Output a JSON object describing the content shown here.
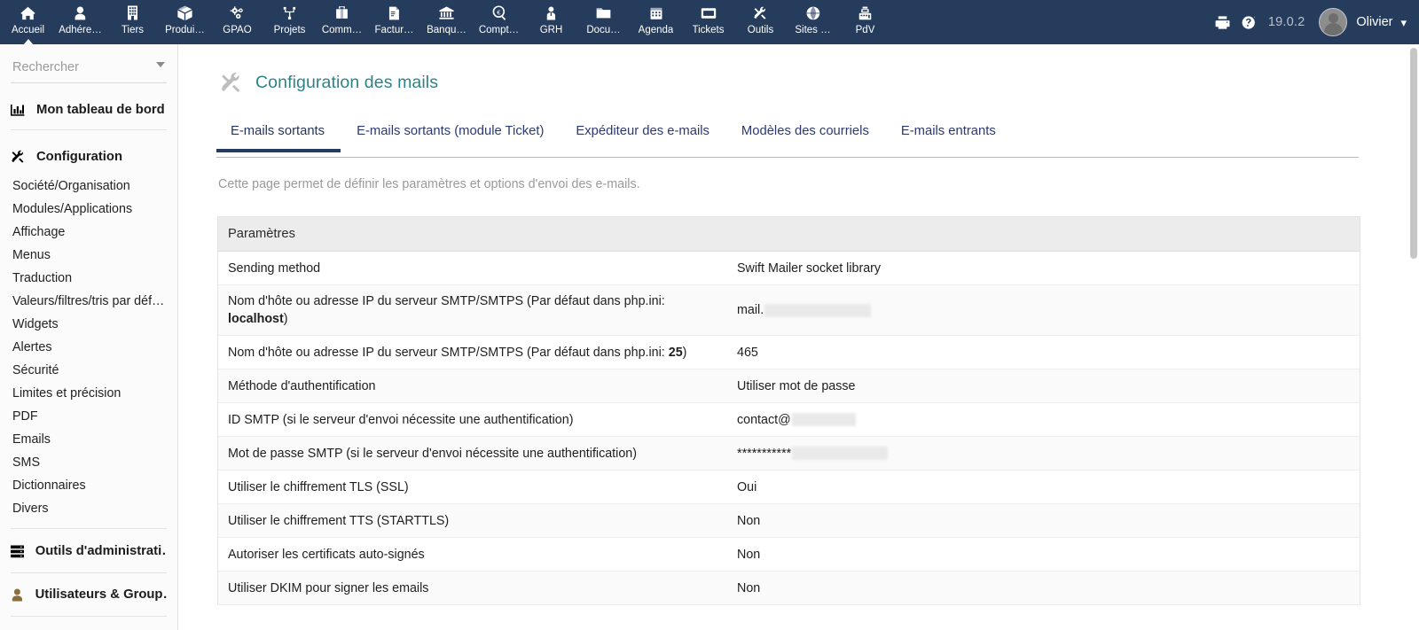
{
  "topnav": {
    "items": [
      {
        "label": "Accueil",
        "icon": "home-icon",
        "active": true
      },
      {
        "label": "Adhére…",
        "icon": "member-icon",
        "active": false
      },
      {
        "label": "Tiers",
        "icon": "building-icon",
        "active": false
      },
      {
        "label": "Produi…",
        "icon": "box-icon",
        "active": false
      },
      {
        "label": "GPAO",
        "icon": "gears-icon",
        "active": false
      },
      {
        "label": "Projets",
        "icon": "project-tree-icon",
        "active": false
      },
      {
        "label": "Comm…",
        "icon": "briefcase-icon",
        "active": false
      },
      {
        "label": "Factur…",
        "icon": "invoice-icon",
        "active": false
      },
      {
        "label": "Banqu…",
        "icon": "bank-icon",
        "active": false
      },
      {
        "label": "Compt…",
        "icon": "accounting-magnifier-icon",
        "active": false
      },
      {
        "label": "GRH",
        "icon": "hr-person-icon",
        "active": false
      },
      {
        "label": "Docu…",
        "icon": "folder-icon",
        "active": false
      },
      {
        "label": "Agenda",
        "icon": "calendar-icon",
        "active": false
      },
      {
        "label": "Tickets",
        "icon": "ticket-icon",
        "active": false
      },
      {
        "label": "Outils",
        "icon": "tools-icon",
        "active": false
      },
      {
        "label": "Sites …",
        "icon": "globe-icon",
        "active": false
      },
      {
        "label": "PdV",
        "icon": "cash-register-icon",
        "active": false
      }
    ],
    "print_icon": "printer-icon",
    "help_icon": "help-question-icon",
    "version": "19.0.2",
    "avatar": "user-avatar",
    "username": "Olivier",
    "user_caret": "chevron-down-icon"
  },
  "sidebar": {
    "search": {
      "placeholder": "Rechercher",
      "value": "",
      "caret": "dropdown-caret-icon"
    },
    "dashboard": {
      "label": "Mon tableau de bord",
      "icon": "chart-bar-icon"
    },
    "configuration": {
      "label": "Configuration",
      "icon": "tools-wrench-icon"
    },
    "config_items": [
      {
        "label": "Société/Organisation"
      },
      {
        "label": "Modules/Applications"
      },
      {
        "label": "Affichage"
      },
      {
        "label": "Menus"
      },
      {
        "label": "Traduction"
      },
      {
        "label": "Valeurs/filtres/tris par déf…"
      },
      {
        "label": "Widgets"
      },
      {
        "label": "Alertes"
      },
      {
        "label": "Sécurité"
      },
      {
        "label": "Limites et précision"
      },
      {
        "label": "PDF"
      },
      {
        "label": "Emails"
      },
      {
        "label": "SMS"
      },
      {
        "label": "Dictionnaires"
      },
      {
        "label": "Divers"
      }
    ],
    "admin_tools": {
      "label": "Outils d'administrati…",
      "icon": "server-rack-icon"
    },
    "users_groups": {
      "label": "Utilisateurs & Group…",
      "icon": "user-icon"
    }
  },
  "page": {
    "title": "Configuration des mails",
    "title_icon": "wrench-tools-icon",
    "description": "Cette page permet de définir les paramètres et options d'envoi des e-mails."
  },
  "tabs": [
    {
      "label": "E-mails sortants",
      "active": true
    },
    {
      "label": "E-mails sortants (module Ticket)",
      "active": false
    },
    {
      "label": "Expéditeur des e-mails",
      "active": false
    },
    {
      "label": "Modèles des courriels",
      "active": false
    },
    {
      "label": "E-mails entrants",
      "active": false
    }
  ],
  "table": {
    "header": "Paramètres",
    "rows": [
      {
        "label": "Sending method",
        "label_bold": "",
        "label_suffix": "",
        "value": "Swift Mailer socket library",
        "redacted_width": 0,
        "tall": false
      },
      {
        "label": "Nom d'hôte ou adresse IP du serveur SMTP/SMTPS (Par défaut dans php.ini: ",
        "label_bold": "localhost",
        "label_suffix": ")",
        "value": "mail.",
        "redacted_width": 120,
        "tall": true
      },
      {
        "label": "Nom d'hôte ou adresse IP du serveur SMTP/SMTPS (Par défaut dans php.ini: ",
        "label_bold": "25",
        "label_suffix": ")",
        "value": "465",
        "redacted_width": 0,
        "tall": false
      },
      {
        "label": "Méthode d'authentification",
        "label_bold": "",
        "label_suffix": "",
        "value": "Utiliser mot de passe",
        "redacted_width": 0,
        "tall": false
      },
      {
        "label": "ID SMTP (si le serveur d'envoi nécessite une authentification)",
        "label_bold": "",
        "label_suffix": "",
        "value": "contact@",
        "redacted_width": 72,
        "tall": false
      },
      {
        "label": "Mot de passe SMTP (si le serveur d'envoi nécessite une authentification)",
        "label_bold": "",
        "label_suffix": "",
        "value": "***********",
        "redacted_width": 108,
        "tall": false
      },
      {
        "label": "Utiliser le chiffrement TLS (SSL)",
        "label_bold": "",
        "label_suffix": "",
        "value": "Oui",
        "redacted_width": 0,
        "tall": false
      },
      {
        "label": "Utiliser le chiffrement TTS (STARTTLS)",
        "label_bold": "",
        "label_suffix": "",
        "value": "Non",
        "redacted_width": 0,
        "tall": false
      },
      {
        "label": "Autoriser les certificats auto-signés",
        "label_bold": "",
        "label_suffix": "",
        "value": "Non",
        "redacted_width": 0,
        "tall": false
      },
      {
        "label": "Utiliser DKIM pour signer les emails",
        "label_bold": "",
        "label_suffix": "",
        "value": "Non",
        "redacted_width": 0,
        "tall": false
      }
    ]
  },
  "colors": {
    "navbar": "#263c5c",
    "title_teal": "#2c8389",
    "tab_link": "#2b3a73",
    "tab_active_underline": "#263c5c",
    "table_header_bg": "#ececec",
    "sidebar_bg": "#fbfbfb",
    "redacted": "#e9e9e9"
  }
}
